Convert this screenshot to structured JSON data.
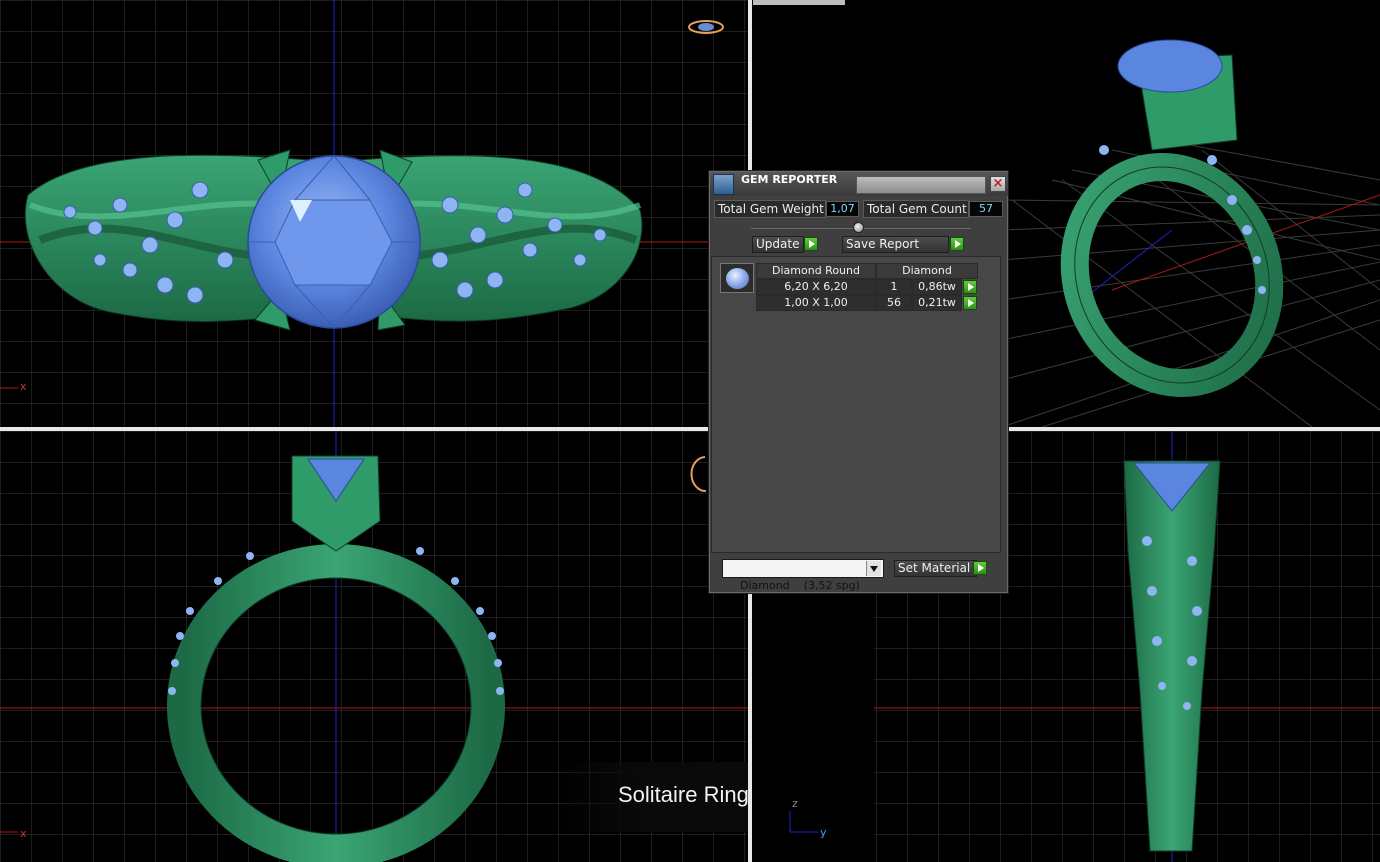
{
  "gem_reporter": {
    "title": "GEM REPORTER",
    "close_glyph": "×",
    "total_weight_label": "Total Gem Weight",
    "total_weight_value": "1,07",
    "total_count_label": "Total Gem Count",
    "total_count_value": "57",
    "update_label": "Update",
    "save_report_label": "Save Report",
    "table": {
      "shape_header": "Diamond Round",
      "material_header": "Diamond",
      "rows": [
        {
          "size": "6,20 X 6,20",
          "count": "1",
          "weight": "0,86tw"
        },
        {
          "size": "1,00 X 1,00",
          "count": "56",
          "weight": "0,21tw"
        }
      ]
    },
    "material_select_value": "Diamond    (3,52 spg)",
    "set_material_label": "Set Material"
  },
  "caption": "Solitaire Ring",
  "axis_labels": {
    "top_left_x": "x",
    "bottom_left_x": "x",
    "bottom_right_z": "z",
    "bottom_right_y": "y"
  },
  "icons": [
    "gem-reporter-icon",
    "close-icon",
    "play-arrow-icon",
    "gem-thumbnail-icon",
    "dropdown-arrow-icon",
    "slider-knob-icon"
  ],
  "colors": {
    "ring_green": "#2a8a5c",
    "gem_blue": "#5b86e0",
    "accent_green_button": "#3faa24",
    "value_text": "#7fd8ff",
    "grid": "#3a3a3a",
    "axis_red": "#b01818",
    "axis_blue": "#2020c8"
  }
}
